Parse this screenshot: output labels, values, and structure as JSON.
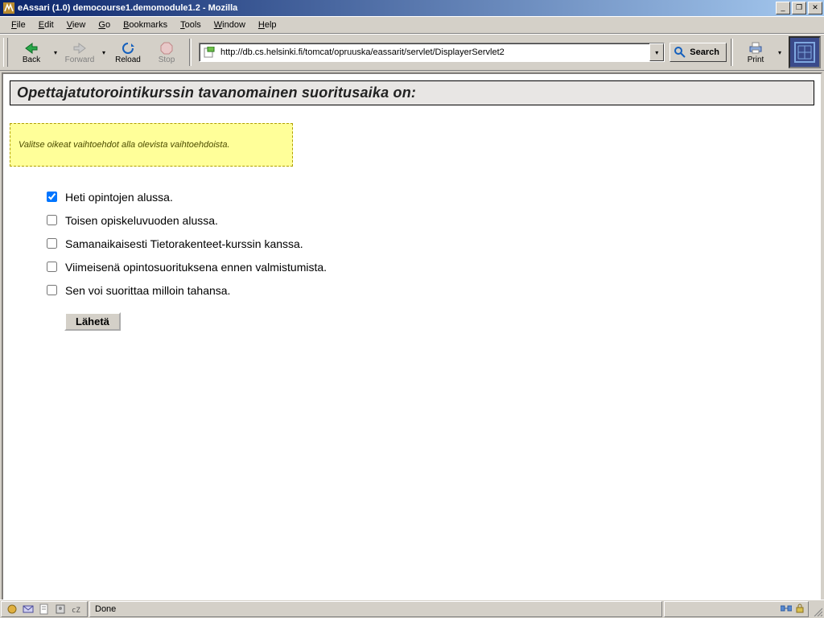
{
  "window": {
    "title": "eAssari (1.0) democourse1.demomodule1.2 - Mozilla"
  },
  "menu": {
    "file": "File",
    "edit": "Edit",
    "view": "View",
    "go": "Go",
    "bookmarks": "Bookmarks",
    "tools": "Tools",
    "window": "Window",
    "help": "Help"
  },
  "toolbar": {
    "back": "Back",
    "forward": "Forward",
    "reload": "Reload",
    "stop": "Stop",
    "search": "Search",
    "print": "Print",
    "url": "http://db.cs.helsinki.fi/tomcat/opruuska/eassarit/servlet/DisplayerServlet2"
  },
  "page": {
    "question_header": "Opettajatutorointikurssin tavanomainen suoritusaika on:",
    "instruction": "Valitse oikeat vaihtoehdot alla olevista vaihtoehdoista.",
    "options": [
      {
        "label": "Heti opintojen alussa.",
        "checked": true
      },
      {
        "label": "Toisen opiskeluvuoden alussa.",
        "checked": false
      },
      {
        "label": "Samanaikaisesti Tietorakenteet-kurssin kanssa.",
        "checked": false
      },
      {
        "label": "Viimeisenä opintosuorituksena ennen valmistumista.",
        "checked": false
      },
      {
        "label": "Sen voi suorittaa milloin tahansa.",
        "checked": false
      }
    ],
    "submit_label": "Lähetä"
  },
  "status": {
    "text": "Done"
  }
}
